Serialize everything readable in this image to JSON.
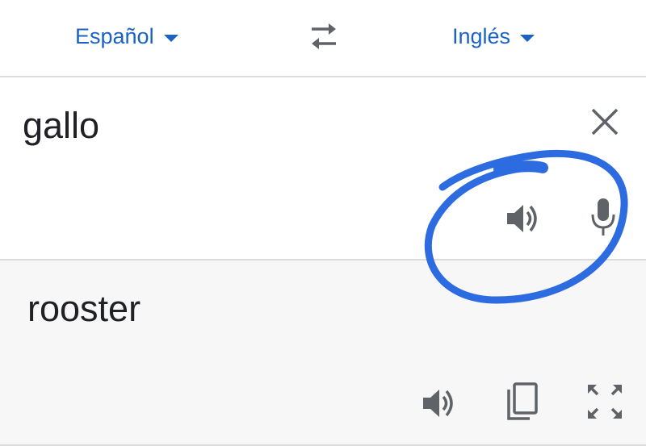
{
  "language_bar": {
    "source_language": "Español",
    "target_language": "Inglés",
    "accent_color": "#1a63c5"
  },
  "source": {
    "text": "gallo"
  },
  "result": {
    "text": "rooster"
  },
  "icons": {
    "swap": "swap-arrows-icon",
    "clear": "close-icon",
    "source_speaker": "speaker-icon",
    "microphone": "microphone-icon",
    "result_speaker": "speaker-icon",
    "copy": "copy-icon",
    "fullscreen": "fullscreen-icon"
  },
  "annotation": {
    "type": "hand-drawn circle",
    "color": "#2d6be0"
  }
}
